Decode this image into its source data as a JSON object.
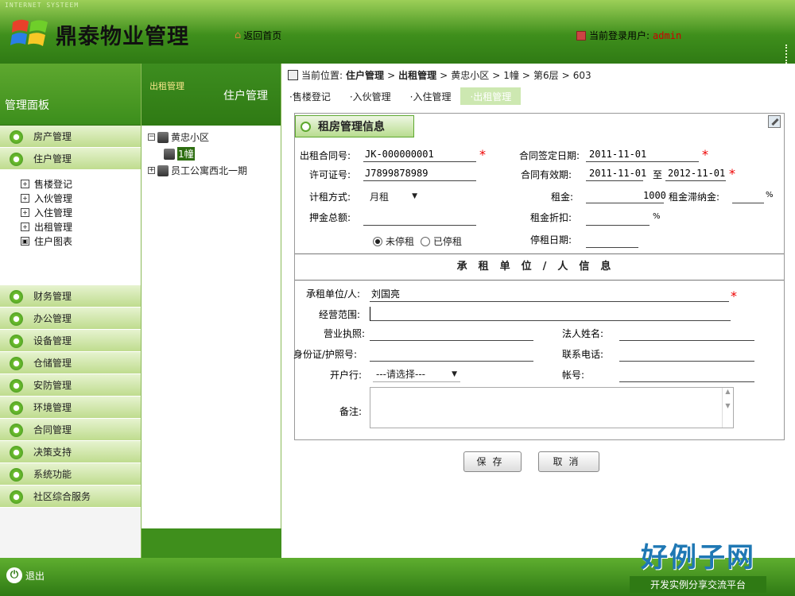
{
  "header": {
    "system_name": "INTERNET SYSTEEM",
    "app_title": "鼎泰物业管理",
    "home_link": "返回首页",
    "current_user_label": "当前登录用户:",
    "current_user": "admin"
  },
  "sidebar": {
    "title": "管理面板",
    "items_top": [
      {
        "label": "房产管理"
      },
      {
        "label": "住户管理"
      }
    ],
    "subitems": [
      {
        "label": "售楼登记",
        "box": "+"
      },
      {
        "label": "入伙管理",
        "box": "+"
      },
      {
        "label": "入住管理",
        "box": "+"
      },
      {
        "label": "出租管理",
        "box": "+"
      },
      {
        "label": "住户图表",
        "box": "▣"
      }
    ],
    "items_bottom": [
      {
        "label": "财务管理"
      },
      {
        "label": "办公管理"
      },
      {
        "label": "设备管理"
      },
      {
        "label": "仓储管理"
      },
      {
        "label": "安防管理"
      },
      {
        "label": "环境管理"
      },
      {
        "label": "合同管理"
      },
      {
        "label": "决策支持"
      },
      {
        "label": "系统功能"
      },
      {
        "label": "社区综合服务"
      }
    ]
  },
  "tree": {
    "header_small": "出租管理",
    "header_main": "住户管理",
    "nodes": [
      {
        "label": "黄忠小区",
        "expander": "−"
      },
      {
        "label": "1幢"
      },
      {
        "label": "员工公寓西北一期",
        "expander": "+"
      }
    ]
  },
  "breadcrumb": {
    "label": "当前位置:",
    "parts": [
      "住户管理",
      "出租管理",
      "黄忠小区",
      "1幢",
      "第6层",
      "603"
    ],
    "sep": ">"
  },
  "subtabs": [
    "·售楼登记",
    "·入伙管理",
    "·入住管理",
    "·出租管理"
  ],
  "form": {
    "title": "租房管理信息",
    "contract_no_label": "出租合同号:",
    "contract_no": "JK-000000001",
    "sign_date_label": "合同签定日期:",
    "sign_date": "2011-11-01",
    "permit_no_label": "许可证号:",
    "permit_no": "J7899878989",
    "valid_label": "合同有效期:",
    "valid_from": "2011-11-01",
    "valid_to_sep": "至",
    "valid_to": "2012-11-01",
    "calc_label": "计租方式:",
    "calc_value": "月租",
    "rent_label": "租金:",
    "rent_value": "1000",
    "late_fee_label": "租金滞纳金:",
    "late_fee_unit": "%",
    "deposit_label": "押金总额:",
    "discount_label": "租金折扣:",
    "discount_unit": "%",
    "radio_active": "未停租",
    "radio_stopped": "已停租",
    "stop_date_label": "停租日期:",
    "tenant_section": "承租单位/人信息",
    "tenant_label": "承租单位/人:",
    "tenant_value": "刘国亮",
    "scope_label": "经营范围:",
    "license_label": "营业执照:",
    "legal_label": "法人姓名:",
    "id_label": "身份证/护照号:",
    "phone_label": "联系电话:",
    "bank_label": "开户行:",
    "bank_value": "---请选择---",
    "account_label": "帐号:",
    "remark_label": "备注:",
    "required_mark": "*"
  },
  "buttons": {
    "save": "保存",
    "cancel": "取消"
  },
  "footer": {
    "logout": "退出",
    "brand_main": "好例子网",
    "brand_sub": "开发实例分享交流平台"
  }
}
